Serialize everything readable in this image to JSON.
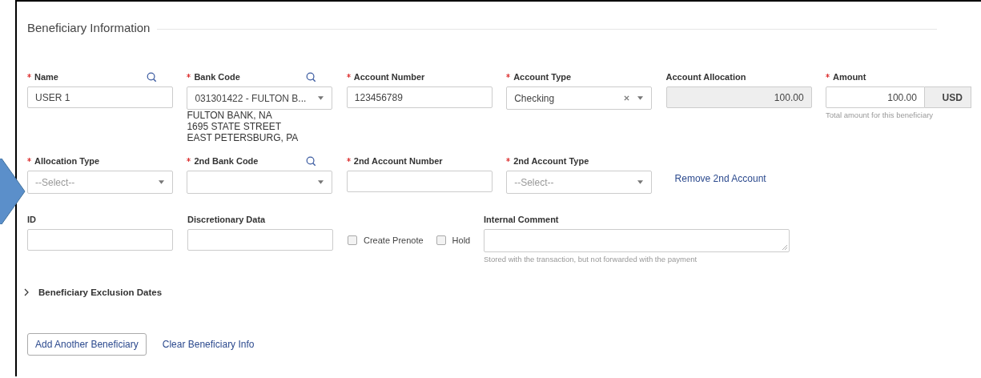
{
  "section": {
    "title": "Beneficiary Information"
  },
  "rows": [
    {
      "fields": [
        {
          "kind": "text",
          "label": "Name",
          "required": true,
          "search": true,
          "value": "USER 1"
        },
        {
          "kind": "select",
          "label": "Bank Code",
          "required": true,
          "search": true,
          "value": "031301422 - FULTON B...",
          "details": [
            "FULTON BANK, NA",
            "1695 STATE STREET",
            "EAST PETERSBURG, PA"
          ]
        },
        {
          "kind": "text",
          "label": "Account Number",
          "required": true,
          "value": "123456789"
        },
        {
          "kind": "select",
          "label": "Account Type",
          "required": true,
          "value": "Checking",
          "clearable": true
        },
        {
          "kind": "text",
          "label": "Account Allocation",
          "required": false,
          "value": "100.00",
          "disabled": true
        },
        {
          "kind": "amount",
          "label": "Amount",
          "required": true,
          "value": "100.00",
          "currency": "USD",
          "hint": "Total amount for this beneficiary"
        }
      ]
    },
    {
      "fields": [
        {
          "kind": "select",
          "label": "Allocation Type",
          "required": true,
          "placeholder": "--Select--"
        },
        {
          "kind": "select",
          "label": "2nd Bank Code",
          "required": true,
          "search": true
        },
        {
          "kind": "text",
          "label": "2nd Account Number",
          "required": true
        },
        {
          "kind": "select",
          "label": "2nd Account Type",
          "required": true,
          "placeholder": "--Select--"
        },
        {
          "kind": "link",
          "text": "Remove 2nd Account"
        }
      ]
    }
  ],
  "extra": {
    "id": {
      "label": "ID"
    },
    "discretionary": {
      "label": "Discretionary Data"
    },
    "checkboxes": [
      {
        "label": "Create Prenote",
        "checked": false
      },
      {
        "label": "Hold",
        "checked": false
      }
    ],
    "comment": {
      "label": "Internal Comment",
      "hint": "Stored with the transaction, but not forwarded with the payment"
    }
  },
  "exclusion": {
    "label": "Beneficiary Exclusion Dates",
    "expanded": false
  },
  "actions": {
    "button": "Add Another Beneficiary",
    "link": "Clear Beneficiary Info"
  }
}
